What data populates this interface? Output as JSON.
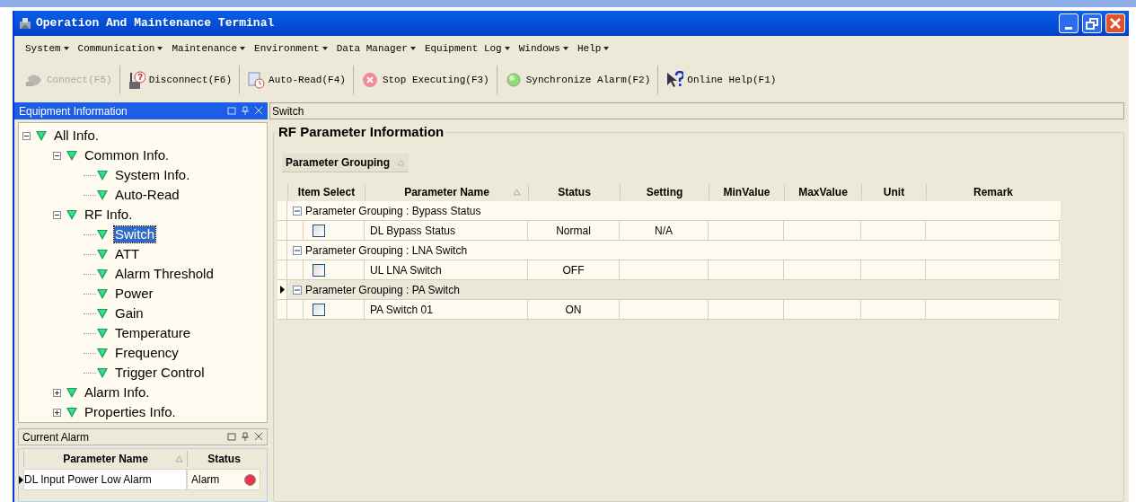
{
  "window": {
    "title": "Operation And Maintenance Terminal"
  },
  "menu": [
    "System",
    "Communication",
    "Maintenance",
    "Environment",
    "Data Manager",
    "Equipment Log",
    "Windows",
    "Help"
  ],
  "toolbar": [
    {
      "label": "Connect(F5)",
      "disabled": true
    },
    {
      "label": "Disconnect(F6)",
      "disabled": false
    },
    {
      "label": "Auto-Read(F4)",
      "disabled": false
    },
    {
      "label": "Stop Executing(F3)",
      "disabled": false
    },
    {
      "label": "Synchronize Alarm(F2)",
      "disabled": false
    },
    {
      "label": "Online Help(F1)",
      "disabled": false
    }
  ],
  "equipment_panel": {
    "title": "Equipment Information",
    "active": true,
    "tree": [
      {
        "label": "All Info.",
        "expanded": true,
        "selected": false,
        "children": [
          {
            "label": "Common Info.",
            "expanded": true,
            "selected": false,
            "children": [
              {
                "label": "System Info.",
                "selected": false
              },
              {
                "label": "Auto-Read",
                "selected": false
              }
            ]
          },
          {
            "label": "RF Info.",
            "expanded": true,
            "selected": false,
            "children": [
              {
                "label": "Switch",
                "selected": true
              },
              {
                "label": "ATT",
                "selected": false
              },
              {
                "label": "Alarm Threshold",
                "selected": false
              },
              {
                "label": "Power",
                "selected": false
              },
              {
                "label": "Gain",
                "selected": false
              },
              {
                "label": "Temperature",
                "selected": false
              },
              {
                "label": "Frequency",
                "selected": false
              },
              {
                "label": "Trigger Control",
                "selected": false
              }
            ]
          },
          {
            "label": "Alarm Info.",
            "expanded": false,
            "selected": false
          },
          {
            "label": "Properties Info.",
            "expanded": false,
            "selected": false
          }
        ]
      }
    ]
  },
  "alarm_panel": {
    "title": "Current Alarm",
    "active": false,
    "columns": [
      {
        "label": "Parameter Name",
        "sorted": true
      },
      {
        "label": "Status",
        "sorted": false
      }
    ],
    "rows": [
      {
        "name": "DL Input Power Low Alarm",
        "status": "Alarm",
        "current": true,
        "color": "#e8384f"
      }
    ]
  },
  "content": {
    "tab": "Switch",
    "group_title": "RF Parameter Information",
    "grouping_button": "Parameter Grouping",
    "columns": [
      {
        "label": "Item Select",
        "sorted": false
      },
      {
        "label": "Parameter Name",
        "sorted": true
      },
      {
        "label": "Status",
        "sorted": false
      },
      {
        "label": "Setting",
        "sorted": false
      },
      {
        "label": "MinValue",
        "sorted": false
      },
      {
        "label": "MaxValue",
        "sorted": false
      },
      {
        "label": "Unit",
        "sorted": false
      },
      {
        "label": "Remark",
        "sorted": false
      }
    ],
    "groups": [
      {
        "label": "Parameter Grouping : Bypass Status",
        "expanded": true,
        "selected": false,
        "rows": [
          {
            "checked": false,
            "name": "DL Bypass Status",
            "status": "Normal",
            "setting": "N/A"
          }
        ]
      },
      {
        "label": "Parameter Grouping : LNA Switch",
        "expanded": true,
        "selected": false,
        "rows": [
          {
            "checked": false,
            "name": "UL LNA Switch",
            "status": "OFF"
          }
        ]
      },
      {
        "label": "Parameter Grouping : PA Switch",
        "expanded": true,
        "selected": true,
        "rows": [
          {
            "checked": false,
            "name": "PA Switch 01",
            "status": "ON"
          }
        ]
      }
    ]
  }
}
